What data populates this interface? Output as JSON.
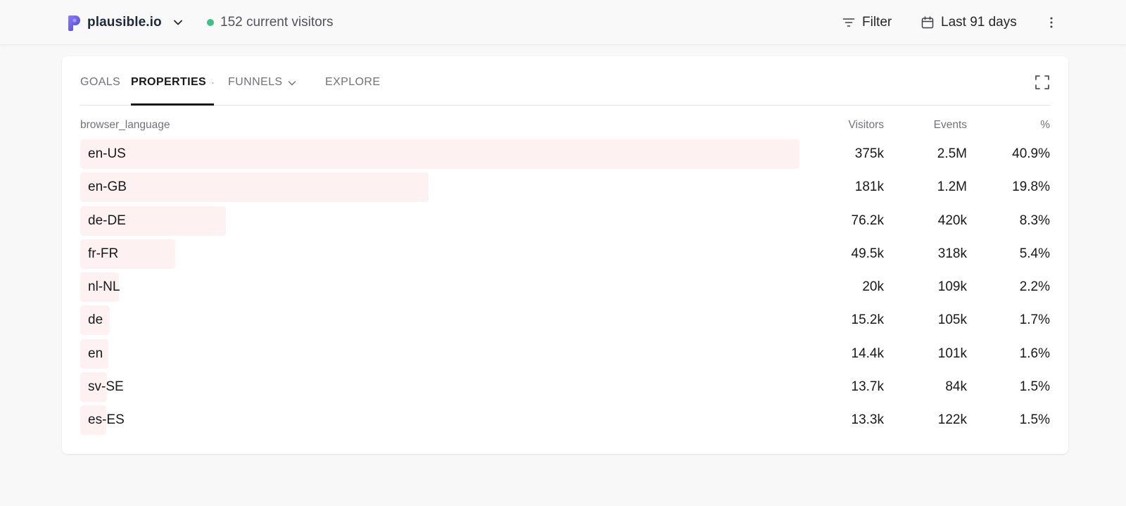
{
  "header": {
    "site_name": "plausible.io",
    "site_logo_icon": "plausible-logo-icon",
    "current_visitors": "152 current visitors",
    "live_color": "#3fbf85",
    "filter_label": "Filter",
    "date_range_label": "Last 91 days"
  },
  "tabs": [
    {
      "label": "GOALS",
      "active": false
    },
    {
      "label": "PROPERTIES",
      "active": true
    },
    {
      "label": "FUNNELS",
      "active": false
    },
    {
      "label": "EXPLORE",
      "active": false
    }
  ],
  "table": {
    "columns": {
      "property": "browser_language",
      "visitors": "Visitors",
      "events": "Events",
      "percent": "%"
    },
    "bar_color": "#fdf2f1",
    "rows": [
      {
        "label": "en-US",
        "visitors": "375k",
        "events": "2.5M",
        "percent": "40.9%",
        "fraction": 1.0
      },
      {
        "label": "en-GB",
        "visitors": "181k",
        "events": "1.2M",
        "percent": "19.8%",
        "fraction": 0.4839
      },
      {
        "label": "de-DE",
        "visitors": "76.2k",
        "events": "420k",
        "percent": "8.3%",
        "fraction": 0.2029
      },
      {
        "label": "fr-FR",
        "visitors": "49.5k",
        "events": "318k",
        "percent": "5.4%",
        "fraction": 0.1318
      },
      {
        "label": "nl-NL",
        "visitors": "20k",
        "events": "109k",
        "percent": "2.2%",
        "fraction": 0.0539
      },
      {
        "label": "de",
        "visitors": "15.2k",
        "events": "105k",
        "percent": "1.7%",
        "fraction": 0.041
      },
      {
        "label": "en",
        "visitors": "14.4k",
        "events": "101k",
        "percent": "1.6%",
        "fraction": 0.039
      },
      {
        "label": "sv-SE",
        "visitors": "13.7k",
        "events": "84k",
        "percent": "1.5%",
        "fraction": 0.037
      },
      {
        "label": "es-ES",
        "visitors": "13.3k",
        "events": "122k",
        "percent": "1.5%",
        "fraction": 0.0359
      }
    ]
  }
}
